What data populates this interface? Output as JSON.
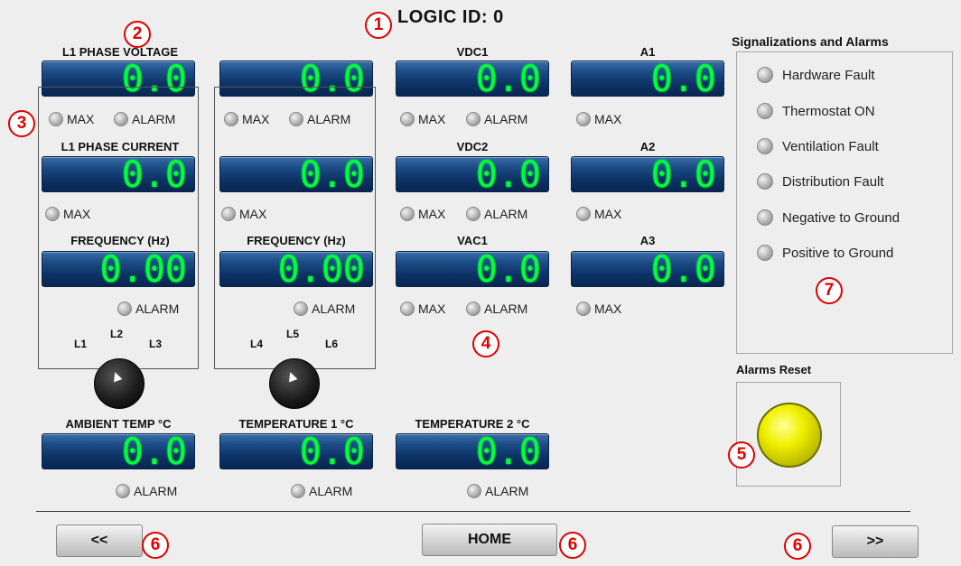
{
  "title": "LOGIC ID:  0",
  "col1": {
    "voltage_label": "L1 PHASE VOLTAGE",
    "voltage_value": "0.0",
    "current_label": "L1 PHASE CURRENT",
    "current_value": "0.0",
    "freq_label": "FREQUENCY (Hz)",
    "freq_value": "0.00",
    "selector": [
      "L1",
      "L2",
      "L3"
    ]
  },
  "col2": {
    "voltage_value": "0.0",
    "current_value": "0.0",
    "freq_label": "FREQUENCY (Hz)",
    "freq_value": "0.00",
    "selector": [
      "L4",
      "L5",
      "L6"
    ]
  },
  "dc": [
    {
      "label": "VDC1",
      "value": "0.0"
    },
    {
      "label": "VDC2",
      "value": "0.0"
    },
    {
      "label": "VAC1",
      "value": "0.0"
    }
  ],
  "amps": [
    {
      "label": "A1",
      "value": "0.0"
    },
    {
      "label": "A2",
      "value": "0.0"
    },
    {
      "label": "A3",
      "value": "0.0"
    }
  ],
  "temps": [
    {
      "label": "AMBIENT TEMP °C",
      "value": "0.0"
    },
    {
      "label": "TEMPERATURE 1 °C",
      "value": "0.0"
    },
    {
      "label": "TEMPERATURE 2 °C",
      "value": "0.0"
    }
  ],
  "lamps": {
    "max": "MAX",
    "alarm": "ALARM"
  },
  "signals": {
    "title": "Signalizations and Alarms",
    "items": [
      "Hardware Fault",
      "Thermostat ON",
      "Ventilation Fault",
      "Distribution Fault",
      "Negative to Ground",
      "Positive to Ground"
    ]
  },
  "reset": {
    "label": "Alarms Reset",
    "color": "#f2f000"
  },
  "nav": {
    "prev": "<<",
    "home": "HOME",
    "next": ">>"
  },
  "badges": [
    "1",
    "2",
    "3",
    "4",
    "5",
    "6",
    "6",
    "6",
    "7"
  ],
  "colors": {
    "display_text": "#00ff3a",
    "display_bg": "#0d3366",
    "badge": "#e00000"
  }
}
